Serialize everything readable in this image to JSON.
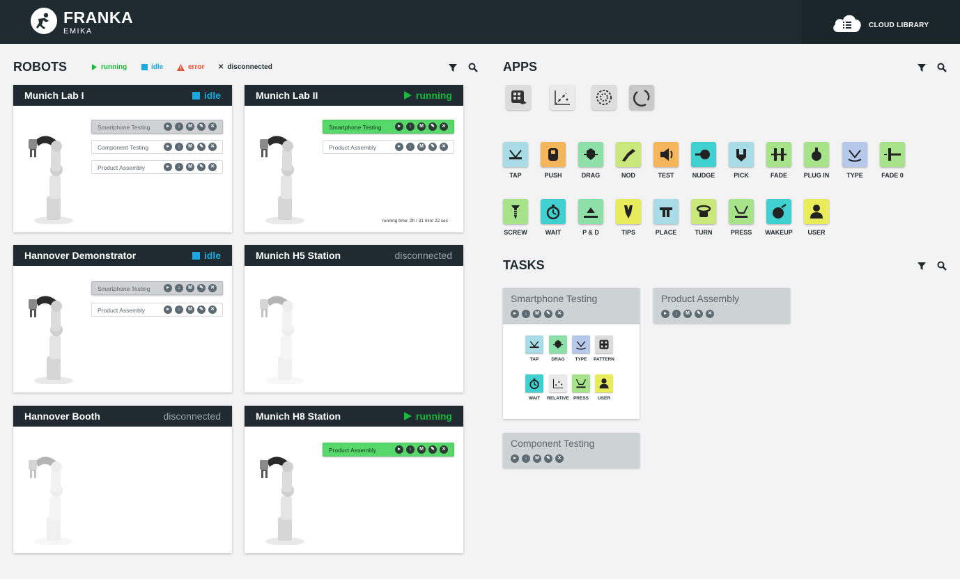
{
  "header": {
    "brand": "FRANKA",
    "brand_sub": "EMIKA",
    "cloud_label": "CLOUD LIBRARY"
  },
  "robots": {
    "title": "ROBOTS",
    "legend": {
      "running": "running",
      "idle": "idle",
      "error": "error",
      "disconnected": "disconnected"
    },
    "cards": [
      {
        "name": "Munich Lab I",
        "status": "idle",
        "tasks": [
          "Smartphone Testing",
          "Component Testing",
          "Product Assembly"
        ],
        "runtime": ""
      },
      {
        "name": "Munich Lab II",
        "status": "running",
        "tasks": [
          "Smartphone Testing",
          "Product Assembly"
        ],
        "runtime": "running time:  2h / 31 min/ 22 sec"
      },
      {
        "name": "Hannover Demonstrator",
        "status": "idle",
        "tasks": [
          "Smartphone Testing",
          "Product Assembly"
        ],
        "runtime": ""
      },
      {
        "name": "Munich H5 Station",
        "status": "disconnected",
        "tasks": [],
        "runtime": ""
      },
      {
        "name": "Hannover Booth",
        "status": "disconnected",
        "tasks": [],
        "runtime": ""
      },
      {
        "name": "Munich H8 Station",
        "status": "running",
        "tasks": [
          "Product Assembly"
        ],
        "runtime": ""
      }
    ]
  },
  "apps": {
    "title": "APPS",
    "items": [
      {
        "label": "TAP",
        "icon": "tap-icon",
        "color": "#a9dce6"
      },
      {
        "label": "PUSH",
        "icon": "push-icon",
        "color": "#f5b55b"
      },
      {
        "label": "DRAG",
        "icon": "drag-icon",
        "color": "#8fe0a8"
      },
      {
        "label": "NOD",
        "icon": "nod-icon",
        "color": "#c9e77a"
      },
      {
        "label": "TEST",
        "icon": "test-icon",
        "color": "#f5b55b"
      },
      {
        "label": "NUDGE",
        "icon": "nudge-icon",
        "color": "#3fd0cf"
      },
      {
        "label": "PICK",
        "icon": "pick-icon",
        "color": "#a9dce6"
      },
      {
        "label": "FADE",
        "icon": "fade-icon",
        "color": "#a7e38a"
      },
      {
        "label": "PLUG IN",
        "icon": "plug-in-icon",
        "color": "#a7e38a"
      },
      {
        "label": "TYPE",
        "icon": "type-icon",
        "color": "#b7c9ea"
      },
      {
        "label": "FADE 0",
        "icon": "fade-0-icon",
        "color": "#a7e38a"
      },
      {
        "label": "SCREW",
        "icon": "screw-icon",
        "color": "#a7e38a"
      },
      {
        "label": "WAIT",
        "icon": "wait-icon",
        "color": "#3fd0cf"
      },
      {
        "label": "P & D",
        "icon": "pick-and-drop-icon",
        "color": "#8fe0a8"
      },
      {
        "label": "TIPS",
        "icon": "tips-icon",
        "color": "#e9ec5a"
      },
      {
        "label": "PLACE",
        "icon": "place-icon",
        "color": "#a9dce6"
      },
      {
        "label": "TURN",
        "icon": "turn-icon",
        "color": "#c9e77a"
      },
      {
        "label": "PRESS",
        "icon": "press-icon",
        "color": "#a7e38a"
      },
      {
        "label": "WAKEUP",
        "icon": "wakeup-icon",
        "color": "#3fd0cf"
      },
      {
        "label": "USER",
        "icon": "user-icon",
        "color": "#e9ec5a"
      }
    ]
  },
  "tasks": {
    "title": "TASKS",
    "cards": [
      {
        "name": "Smartphone Testing",
        "apps": [
          "TAP",
          "DRAG",
          "TYPE",
          "PATTERN",
          "WAIT",
          "RELATIVE",
          "PRESS",
          "USER"
        ]
      },
      {
        "name": "Product Assembly"
      },
      {
        "name": "Component Testing"
      }
    ]
  },
  "colors": {
    "running": "#19b83a",
    "idle": "#1aa8e0",
    "error": "#e54a2e",
    "disconnected": "#1e2a30",
    "header": "#1f2b31"
  }
}
